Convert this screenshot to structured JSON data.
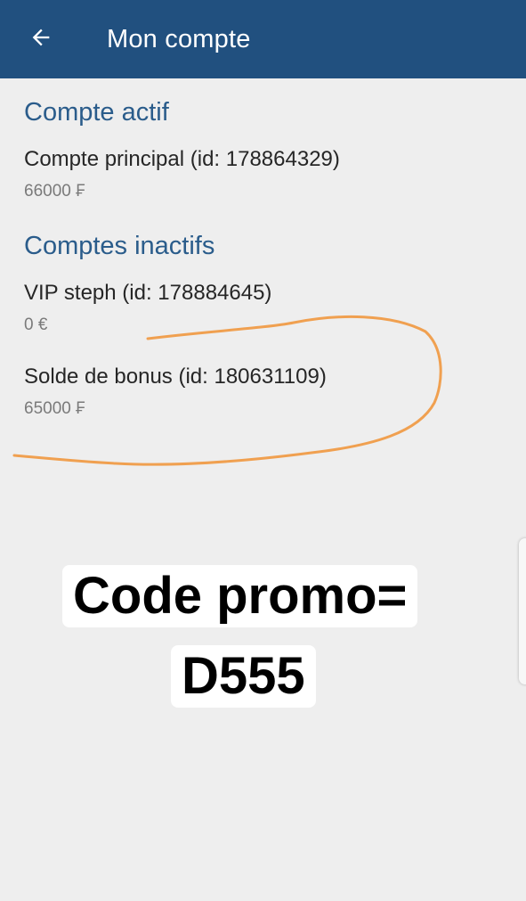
{
  "appbar": {
    "title": "Mon compte",
    "back_icon": "arrow-left-icon",
    "background": "#21507f"
  },
  "active_section": {
    "heading": "Compte actif",
    "accounts": [
      {
        "name": "Compte principal (id: 178864329)",
        "balance": "66000 ₣"
      }
    ]
  },
  "inactive_section": {
    "heading": "Comptes inactifs",
    "accounts": [
      {
        "name": "VIP steph (id: 178884645)",
        "balance": "0 €"
      },
      {
        "name": "Solde de bonus (id: 180631109)",
        "balance": "65000 ₣"
      }
    ]
  },
  "overlay": {
    "promo_line1": "Code promo=",
    "promo_line2": "D555",
    "highlight_color": "#f0a050"
  },
  "colors": {
    "heading": "#2a5c8b",
    "page_bg": "#eeeeee"
  }
}
